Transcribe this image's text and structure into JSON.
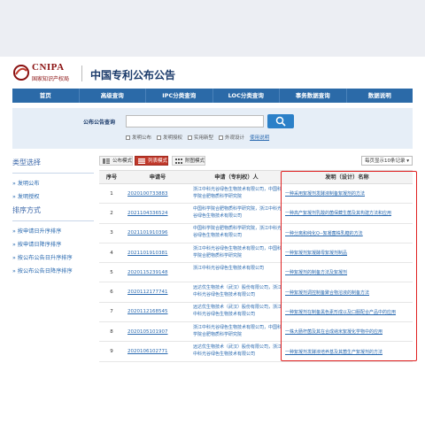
{
  "header": {
    "logo_text": "CNIPA",
    "logo_subtext": "国家知识产权局",
    "site_title": "中国专利公布公告"
  },
  "nav": {
    "items": [
      "首页",
      "高级查询",
      "IPC分类查询",
      "LOC分类查询",
      "事务数据查询",
      "数据说明"
    ]
  },
  "search": {
    "label": "公布公告查询",
    "value": "",
    "filters": [
      "发明公布",
      "发明授权",
      "实用新型",
      "外观设计"
    ],
    "help_link": "使用说明"
  },
  "sidebar": {
    "type_heading": "类型选择",
    "type_items": [
      "发明公布",
      "发明授权"
    ],
    "sort_heading": "排序方式",
    "sort_items": [
      "按申请日升序排序",
      "按申请日降序排序",
      "按公布公告日升序排序",
      "按公布公告日降序排序"
    ]
  },
  "modes": {
    "abstract": "公布模式",
    "list": "列表模式",
    "image": "附图模式",
    "per_page": "每页显示10条记录"
  },
  "table": {
    "headers": [
      "序号",
      "申请号",
      "申请（专利权）人",
      "发明（设计）名称"
    ],
    "rows": [
      {
        "no": "1",
        "app_no": "2020100733883",
        "applicant": "浙江中科光谷绿色生物技术有限公司，中国科学院合肥物质科学研究院",
        "title": "一种采用絮凝剂发酵液制备絮凝剂的方法"
      },
      {
        "no": "2",
        "app_no": "2021104336524",
        "applicant": "中国科学院合肥物质科学研究院，浙江中科光谷绿色生物技术有限公司",
        "title": "一种高产絮凝剂乳酸的菌保藏生菌及其构建方法和应用"
      },
      {
        "no": "3",
        "app_no": "2021101910396",
        "applicant": "中国科学院合肥物质科学研究院，浙江中科光谷绿色生物技术有限公司",
        "title": "一种分离和纯化Q--絮凝菌株乳糖的方法"
      },
      {
        "no": "4",
        "app_no": "2021101910381",
        "applicant": "浙江中科光谷绿色生物技术有限公司，中国科学院合肥物质科学研究院",
        "title": "一种絮凝剂絮凝酵母絮凝剂制品"
      },
      {
        "no": "5",
        "app_no": "2020115239148",
        "applicant": "浙江中科光谷绿色生物技术有限公司",
        "title": "一种絮凝剂的制备方法及絮凝剂"
      },
      {
        "no": "6",
        "app_no": "2020112177741",
        "applicant": "远达优生物技术（武汉）股份有限公司，浙江中科光谷绿色生物技术有限公司",
        "title": "一种絮凝剂调控制备聚合物溶液的制备方法"
      },
      {
        "no": "7",
        "app_no": "2020112168545",
        "applicant": "远达优生物技术（武汉）股份有限公司，浙江中科光谷绿色生物技术有限公司",
        "title": "一种絮凝剂在制备黑色素形成以及口服配合产品中的应用"
      },
      {
        "no": "8",
        "app_no": "2020105101907",
        "applicant": "浙江中科光谷绿色生物技术有限公司，中国科学院合肥物质科学研究院",
        "title": "一株大肠杆菌及其在合成纳米絮凝化学物中的应用"
      },
      {
        "no": "9",
        "app_no": "2020106102771",
        "applicant": "远达优生物技术（武汉）股份有限公司，浙江中科光谷绿色生物技术有限公司",
        "title": "一种絮凝剂发酵液培养基及其菌生产絮凝剂的方法"
      }
    ]
  }
}
